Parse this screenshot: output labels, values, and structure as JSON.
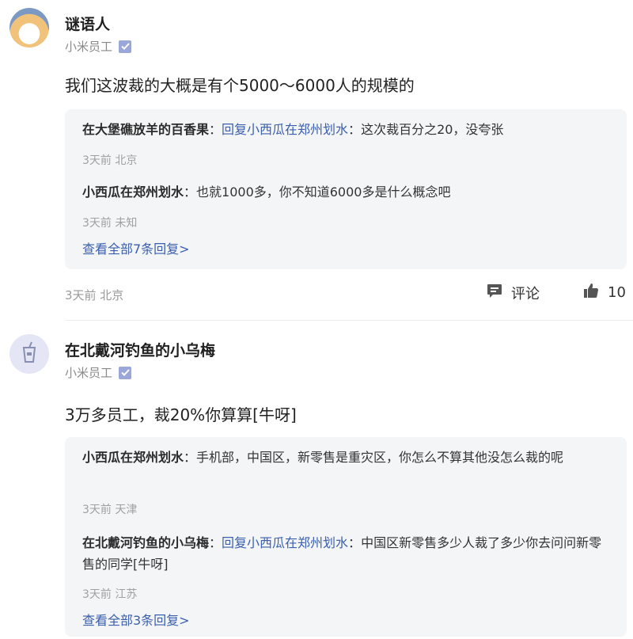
{
  "posts": [
    {
      "username": "谜语人",
      "badge_text": "小米员工",
      "content": "我们这波裁的大概是有个5000～6000人的规模的",
      "replies": [
        {
          "author": "在大堡礁放羊的百香果",
          "reply_to": "回复小西瓜在郑州划水",
          "text": "这次裁百分之20，没夸张",
          "meta": "3天前 北京"
        },
        {
          "author": "小西瓜在郑州划水",
          "reply_to": "",
          "text": "也就1000多，你不知道6000多是什么概念吧",
          "meta": "3天前 未知"
        }
      ],
      "view_all": "查看全部7条回复>",
      "footer_meta": "3天前 北京",
      "comment_label": "评论",
      "like_count": "10"
    },
    {
      "username": "在北戴河钓鱼的小乌梅",
      "badge_text": "小米员工",
      "content": "3万多员工，裁20%你算算[牛呀]",
      "replies": [
        {
          "author": "小西瓜在郑州划水",
          "reply_to": "",
          "text": "手机部，中国区，新零售是重灾区，你怎么不算其他没怎么裁的呢",
          "meta": "3天前 天津"
        },
        {
          "author": "在北戴河钓鱼的小乌梅",
          "reply_to": "回复小西瓜在郑州划水",
          "text": "中国区新零售多少人裁了多少你去问问新零售的同学[牛呀]",
          "meta": "3天前 江苏"
        }
      ],
      "view_all": "查看全部3条回复>"
    }
  ],
  "colors": {
    "link": "#3b5fae",
    "reply_bg": "#f4f5f7",
    "muted": "#a0a0a0"
  },
  "icons": [
    "verified-badge-icon",
    "comment-icon",
    "thumbs-up-icon",
    "cup-icon"
  ]
}
